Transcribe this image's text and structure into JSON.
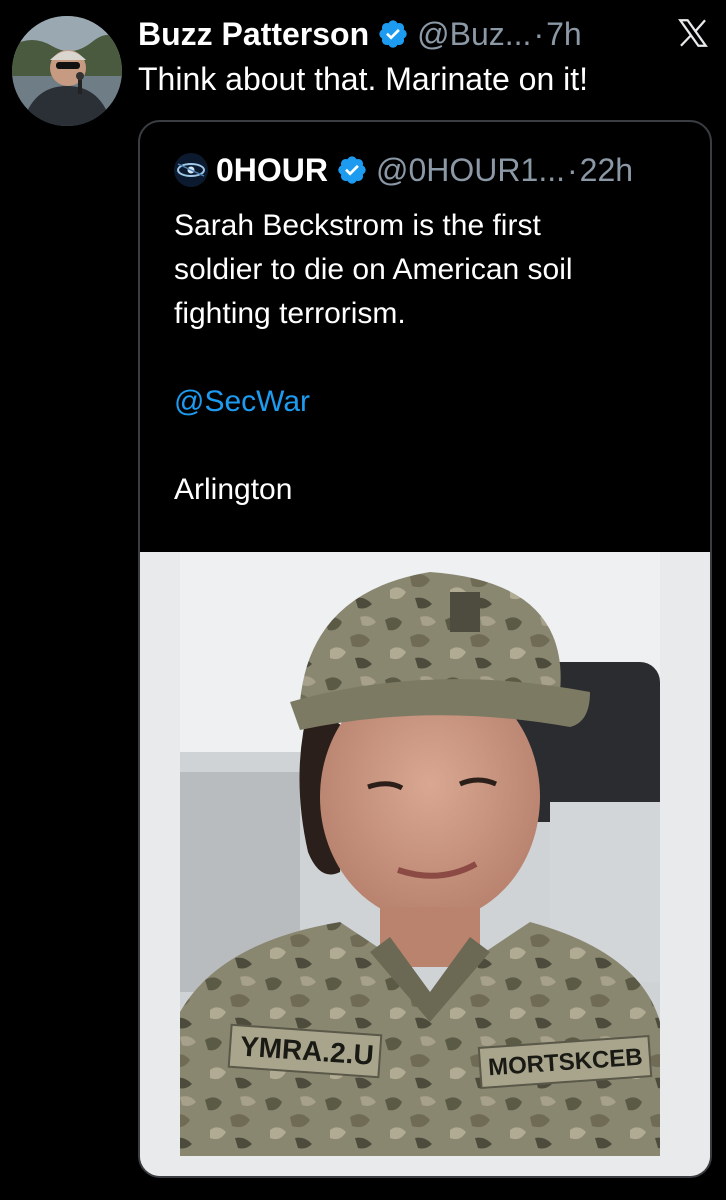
{
  "tweet": {
    "author": {
      "display_name": "Buzz Patterson",
      "handle": "@Buz...",
      "separator": "·",
      "time": "7h",
      "verified": true,
      "avatar": "profile-photo"
    },
    "text": "Think about that. Marinate on it!",
    "platform_icon": "x-logo-icon"
  },
  "quote": {
    "author": {
      "display_name": "0HOUR",
      "handle": "@0HOUR1...",
      "separator": "·",
      "time": "22h",
      "verified": true,
      "avatar": "profile-avatar"
    },
    "lines": [
      "Sarah Beckstrom is the first",
      "soldier to die on American soil",
      "fighting terrorism."
    ],
    "mention": "@SecWar",
    "place": "Arlington",
    "photo": {
      "name_tape_left": "YMRA.2.U",
      "name_tape_right": "MORTSKCEB"
    }
  },
  "colors": {
    "background": "#000000",
    "text": "#ffffff",
    "muted": "#8b98a5",
    "link": "#1d9bf0",
    "verified": "#1d9bf0",
    "border": "#3a3d41"
  }
}
